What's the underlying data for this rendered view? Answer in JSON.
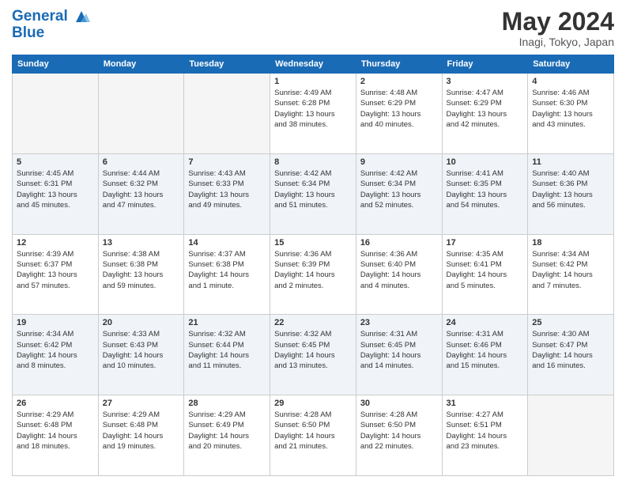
{
  "header": {
    "logo_line1": "General",
    "logo_line2": "Blue",
    "month": "May 2024",
    "location": "Inagi, Tokyo, Japan"
  },
  "weekdays": [
    "Sunday",
    "Monday",
    "Tuesday",
    "Wednesday",
    "Thursday",
    "Friday",
    "Saturday"
  ],
  "weeks": [
    [
      {
        "day": "",
        "info": ""
      },
      {
        "day": "",
        "info": ""
      },
      {
        "day": "",
        "info": ""
      },
      {
        "day": "1",
        "info": "Sunrise: 4:49 AM\nSunset: 6:28 PM\nDaylight: 13 hours\nand 38 minutes."
      },
      {
        "day": "2",
        "info": "Sunrise: 4:48 AM\nSunset: 6:29 PM\nDaylight: 13 hours\nand 40 minutes."
      },
      {
        "day": "3",
        "info": "Sunrise: 4:47 AM\nSunset: 6:29 PM\nDaylight: 13 hours\nand 42 minutes."
      },
      {
        "day": "4",
        "info": "Sunrise: 4:46 AM\nSunset: 6:30 PM\nDaylight: 13 hours\nand 43 minutes."
      }
    ],
    [
      {
        "day": "5",
        "info": "Sunrise: 4:45 AM\nSunset: 6:31 PM\nDaylight: 13 hours\nand 45 minutes."
      },
      {
        "day": "6",
        "info": "Sunrise: 4:44 AM\nSunset: 6:32 PM\nDaylight: 13 hours\nand 47 minutes."
      },
      {
        "day": "7",
        "info": "Sunrise: 4:43 AM\nSunset: 6:33 PM\nDaylight: 13 hours\nand 49 minutes."
      },
      {
        "day": "8",
        "info": "Sunrise: 4:42 AM\nSunset: 6:34 PM\nDaylight: 13 hours\nand 51 minutes."
      },
      {
        "day": "9",
        "info": "Sunrise: 4:42 AM\nSunset: 6:34 PM\nDaylight: 13 hours\nand 52 minutes."
      },
      {
        "day": "10",
        "info": "Sunrise: 4:41 AM\nSunset: 6:35 PM\nDaylight: 13 hours\nand 54 minutes."
      },
      {
        "day": "11",
        "info": "Sunrise: 4:40 AM\nSunset: 6:36 PM\nDaylight: 13 hours\nand 56 minutes."
      }
    ],
    [
      {
        "day": "12",
        "info": "Sunrise: 4:39 AM\nSunset: 6:37 PM\nDaylight: 13 hours\nand 57 minutes."
      },
      {
        "day": "13",
        "info": "Sunrise: 4:38 AM\nSunset: 6:38 PM\nDaylight: 13 hours\nand 59 minutes."
      },
      {
        "day": "14",
        "info": "Sunrise: 4:37 AM\nSunset: 6:38 PM\nDaylight: 14 hours\nand 1 minute."
      },
      {
        "day": "15",
        "info": "Sunrise: 4:36 AM\nSunset: 6:39 PM\nDaylight: 14 hours\nand 2 minutes."
      },
      {
        "day": "16",
        "info": "Sunrise: 4:36 AM\nSunset: 6:40 PM\nDaylight: 14 hours\nand 4 minutes."
      },
      {
        "day": "17",
        "info": "Sunrise: 4:35 AM\nSunset: 6:41 PM\nDaylight: 14 hours\nand 5 minutes."
      },
      {
        "day": "18",
        "info": "Sunrise: 4:34 AM\nSunset: 6:42 PM\nDaylight: 14 hours\nand 7 minutes."
      }
    ],
    [
      {
        "day": "19",
        "info": "Sunrise: 4:34 AM\nSunset: 6:42 PM\nDaylight: 14 hours\nand 8 minutes."
      },
      {
        "day": "20",
        "info": "Sunrise: 4:33 AM\nSunset: 6:43 PM\nDaylight: 14 hours\nand 10 minutes."
      },
      {
        "day": "21",
        "info": "Sunrise: 4:32 AM\nSunset: 6:44 PM\nDaylight: 14 hours\nand 11 minutes."
      },
      {
        "day": "22",
        "info": "Sunrise: 4:32 AM\nSunset: 6:45 PM\nDaylight: 14 hours\nand 13 minutes."
      },
      {
        "day": "23",
        "info": "Sunrise: 4:31 AM\nSunset: 6:45 PM\nDaylight: 14 hours\nand 14 minutes."
      },
      {
        "day": "24",
        "info": "Sunrise: 4:31 AM\nSunset: 6:46 PM\nDaylight: 14 hours\nand 15 minutes."
      },
      {
        "day": "25",
        "info": "Sunrise: 4:30 AM\nSunset: 6:47 PM\nDaylight: 14 hours\nand 16 minutes."
      }
    ],
    [
      {
        "day": "26",
        "info": "Sunrise: 4:29 AM\nSunset: 6:48 PM\nDaylight: 14 hours\nand 18 minutes."
      },
      {
        "day": "27",
        "info": "Sunrise: 4:29 AM\nSunset: 6:48 PM\nDaylight: 14 hours\nand 19 minutes."
      },
      {
        "day": "28",
        "info": "Sunrise: 4:29 AM\nSunset: 6:49 PM\nDaylight: 14 hours\nand 20 minutes."
      },
      {
        "day": "29",
        "info": "Sunrise: 4:28 AM\nSunset: 6:50 PM\nDaylight: 14 hours\nand 21 minutes."
      },
      {
        "day": "30",
        "info": "Sunrise: 4:28 AM\nSunset: 6:50 PM\nDaylight: 14 hours\nand 22 minutes."
      },
      {
        "day": "31",
        "info": "Sunrise: 4:27 AM\nSunset: 6:51 PM\nDaylight: 14 hours\nand 23 minutes."
      },
      {
        "day": "",
        "info": ""
      }
    ]
  ]
}
